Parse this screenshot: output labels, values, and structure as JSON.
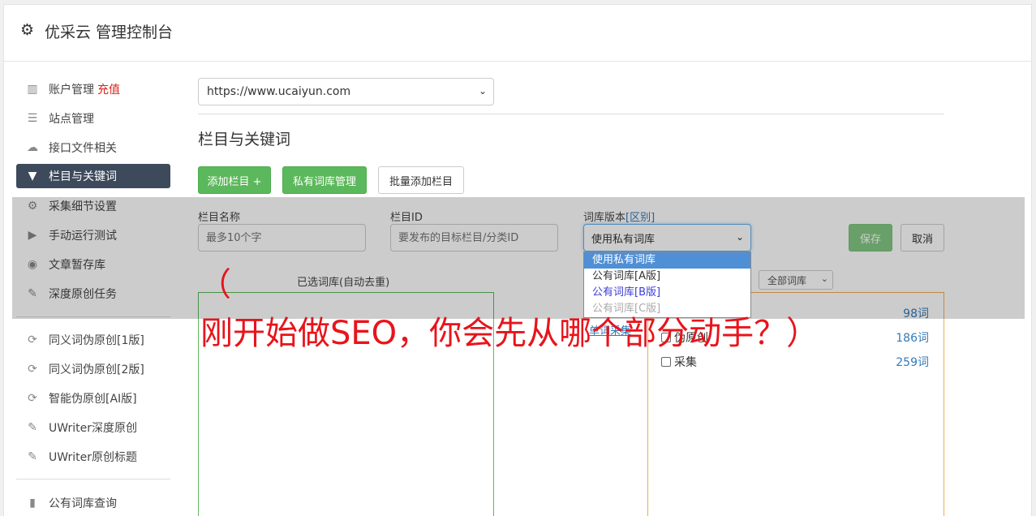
{
  "header": {
    "title": "优采云 管理控制台",
    "icon": "gear-icon"
  },
  "sidebar": {
    "items": [
      {
        "label": "账户管理",
        "extra": "充值",
        "icon": "bar-chart-icon"
      },
      {
        "label": "站点管理",
        "icon": "server-icon"
      },
      {
        "label": "接口文件相关",
        "icon": "cloud-upload-icon"
      },
      {
        "label": "栏目与关键词",
        "icon": "filter-icon",
        "active": true
      },
      {
        "label": "采集细节设置",
        "icon": "cogs-icon"
      },
      {
        "label": "手动运行测试",
        "icon": "play-circle-icon"
      },
      {
        "label": "文章暂存库",
        "icon": "database-icon"
      },
      {
        "label": "深度原创任务",
        "icon": "edit-icon"
      },
      {
        "label": "同义词伪原创[1版]",
        "icon": "refresh-icon"
      },
      {
        "label": "同义词伪原创[2版]",
        "icon": "refresh-icon"
      },
      {
        "label": "智能伪原创[AI版]",
        "icon": "refresh-icon"
      },
      {
        "label": "UWriter深度原创",
        "icon": "edit-icon"
      },
      {
        "label": "UWriter原创标题",
        "icon": "edit-icon"
      },
      {
        "label": "公有词库查询",
        "icon": "book-icon"
      }
    ]
  },
  "site_select": {
    "value": "https://www.ucaiyun.com"
  },
  "section_title": "栏目与关键词",
  "buttons": {
    "add_column": "添加栏目 +",
    "private_lib": "私有词库管理",
    "batch_add": "批量添加栏目",
    "save": "保存",
    "cancel": "取消"
  },
  "form": {
    "column_name_label": "栏目名称",
    "column_name_placeholder": "最多10个字",
    "column_id_label": "栏目ID",
    "column_id_placeholder": "要发布的目标栏目/分类ID",
    "lib_version_label": "词库版本",
    "lib_version_link": "[区别]",
    "lib_version_value": "使用私有词库",
    "lib_options": [
      "使用私有词库",
      "公有词库[A版]",
      "公有词库[B版]",
      "公有词库[C版]"
    ]
  },
  "panels": {
    "left_title": "已选词库(自动去重)",
    "right_filter": "全部词库",
    "link": "单词采集",
    "libraries": [
      {
        "name": "伪原创",
        "count": "186词"
      },
      {
        "name": "采集",
        "count": "259词"
      }
    ],
    "first_count": "98词"
  },
  "caption": {
    "paren": "（",
    "text": "刚开始做SEO，你会先从哪个部分动手？）"
  },
  "colors": {
    "accent_green": "#5cb85c",
    "active_nav": "#3d4a5c",
    "caption_red": "#e8141b"
  }
}
